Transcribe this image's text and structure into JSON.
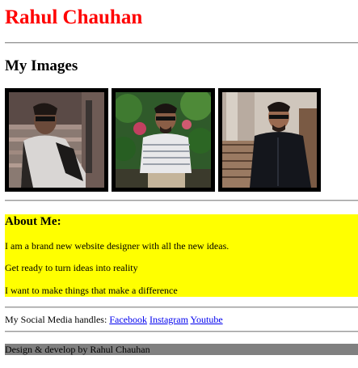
{
  "header": {
    "title": "Rahul Chauhan"
  },
  "images_section": {
    "heading": "My Images",
    "photos": [
      {
        "alt": "photo-1"
      },
      {
        "alt": "photo-2"
      },
      {
        "alt": "photo-3"
      }
    ]
  },
  "about": {
    "heading": "About Me:",
    "lines": [
      "I am a brand new website designer with all the new ideas.",
      "Get ready to turn ideas into reality",
      "I want to make things that make a difference"
    ]
  },
  "social": {
    "label": "My Social Media handles:",
    "links": [
      "Facebook",
      "Instagram",
      "Youtube"
    ]
  },
  "footer": {
    "text": "Design & develop by Rahul Chauhan"
  },
  "colors": {
    "title": "#ff0000",
    "about_bg": "#ffff00",
    "footer_bg": "#808080",
    "link": "#0000ee"
  }
}
